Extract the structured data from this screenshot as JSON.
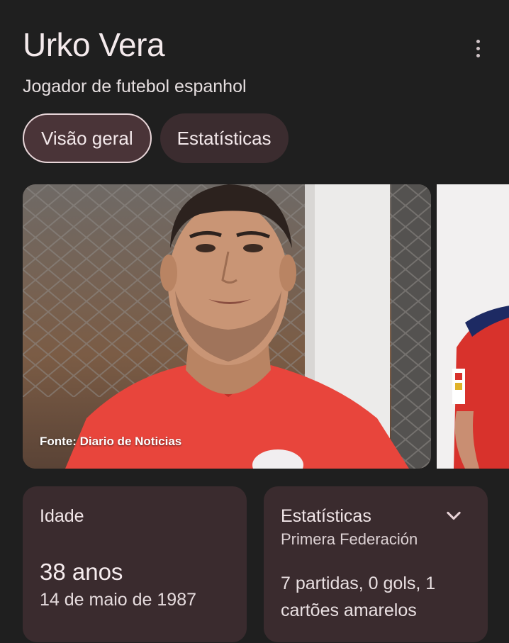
{
  "header": {
    "title": "Urko Vera",
    "subtitle": "Jogador de futebol espanhol",
    "menu_icon": "more-vert-icon"
  },
  "tabs": [
    {
      "label": "Visão geral",
      "active": true
    },
    {
      "label": "Estatísticas",
      "active": false
    }
  ],
  "images": {
    "main_source": "Fonte: Diario de Noticias"
  },
  "age_card": {
    "label": "Idade",
    "value": "38 anos",
    "birth_date": "14 de maio de 1987"
  },
  "stats_card": {
    "label": "Estatísticas",
    "competition": "Primera Federación",
    "summary": "7 partidas, 0 gols, 1 cartões amarelos",
    "expand_icon": "chevron-down-icon"
  },
  "colors": {
    "background": "#1f1f1f",
    "chip": "#3b2c2f",
    "chip_active_border": "#e8d6d9",
    "card": "#3a2b2e",
    "shirt_red": "#e8453c"
  }
}
